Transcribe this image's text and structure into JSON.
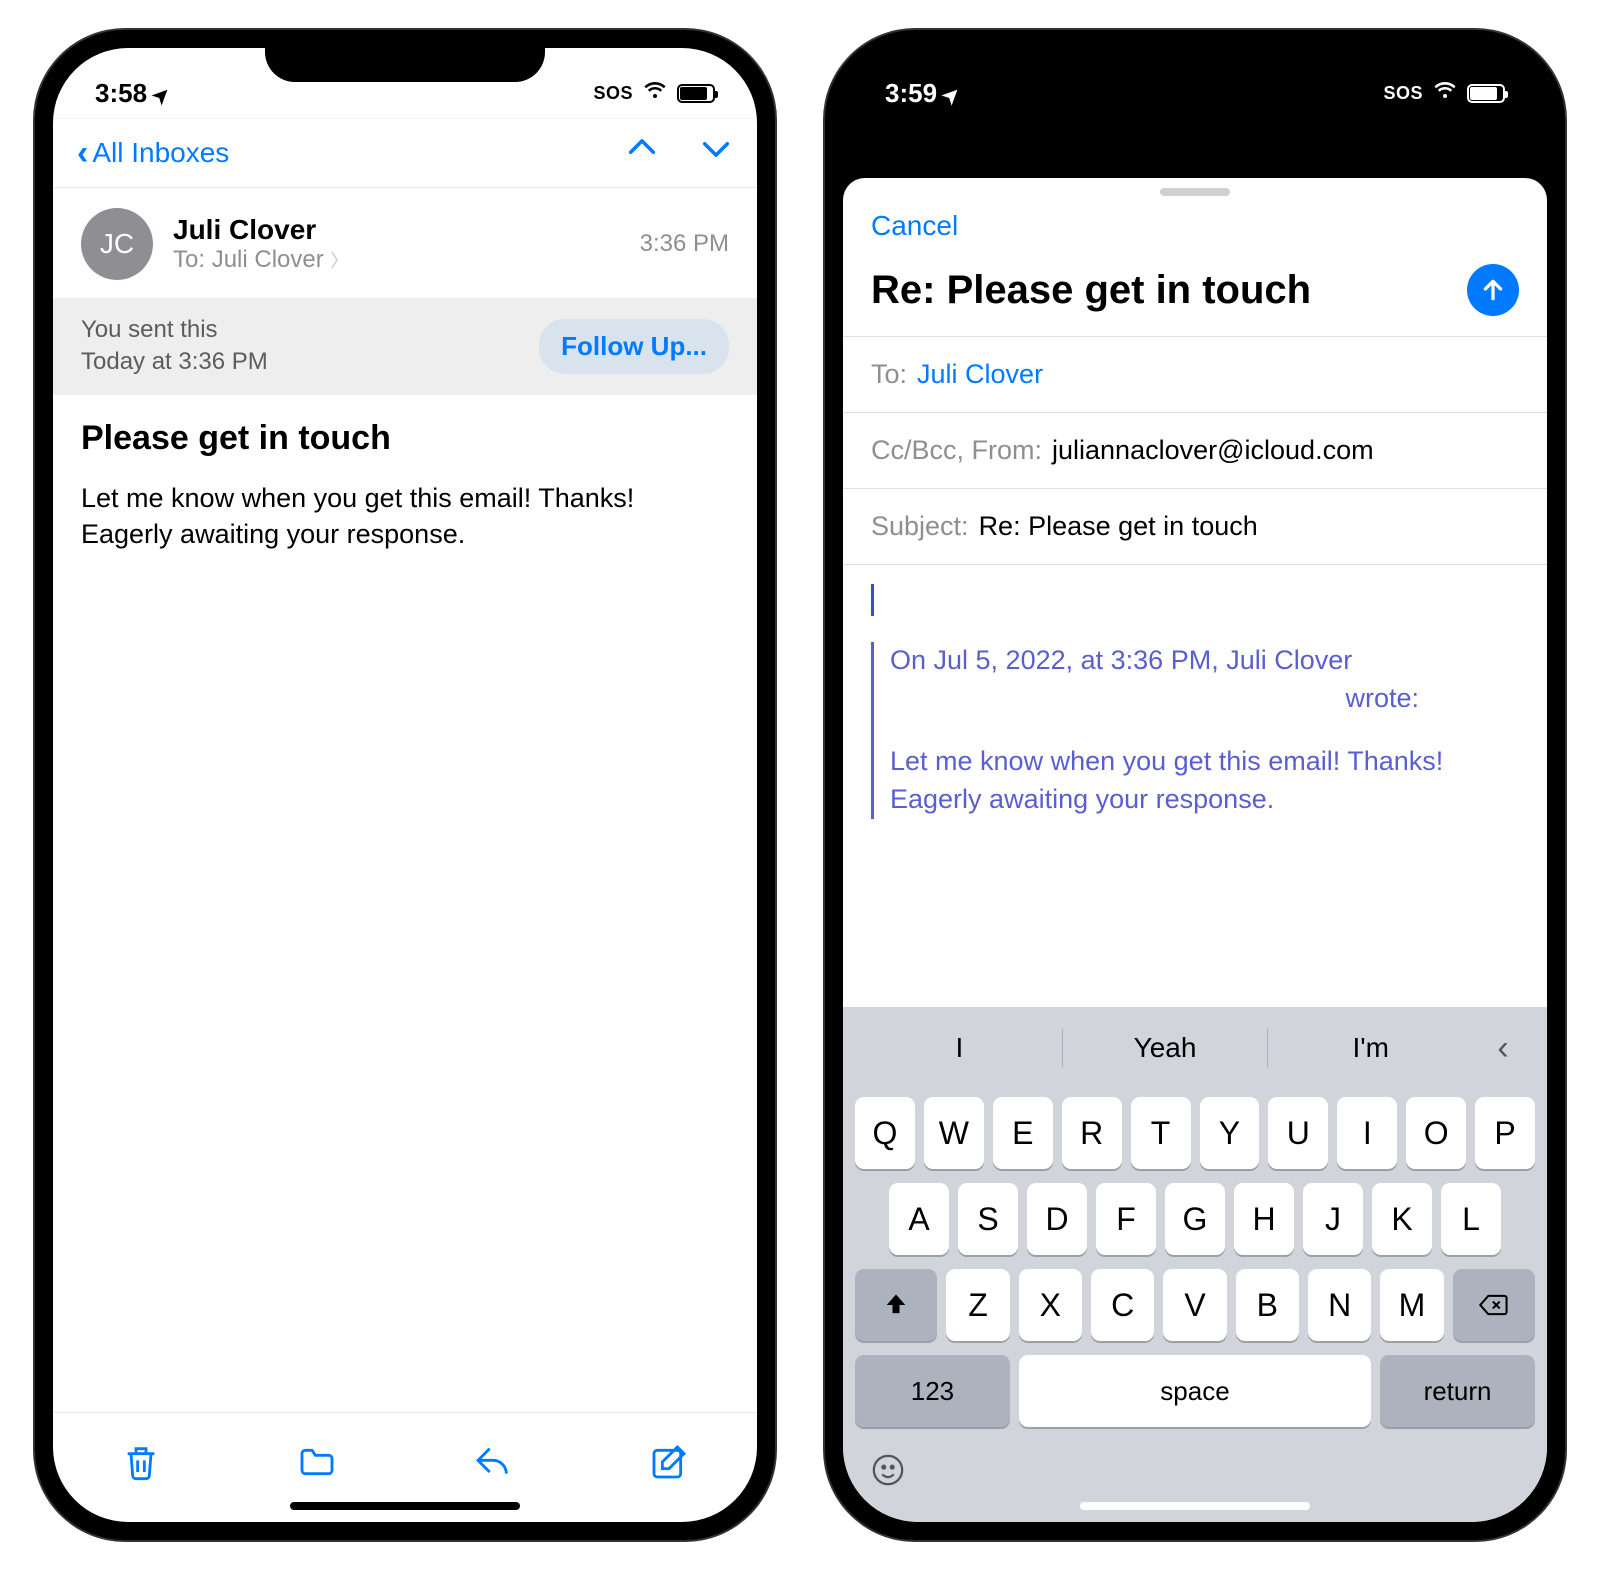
{
  "phone1": {
    "status": {
      "time": "3:58",
      "sos": "SOS"
    },
    "nav": {
      "back": "All Inboxes"
    },
    "sender": {
      "initials": "JC",
      "name": "Juli Clover",
      "to_label": "To:",
      "to_name": "Juli Clover",
      "time": "3:36 PM"
    },
    "banner": {
      "line1": "You sent this",
      "line2": "Today at 3:36 PM",
      "button": "Follow Up..."
    },
    "subject": "Please get in touch",
    "body": "Let me know when you get this email! Thanks! Eagerly awaiting your response."
  },
  "phone2": {
    "status": {
      "time": "3:59",
      "sos": "SOS"
    },
    "cancel": "Cancel",
    "subject": "Re: Please get in touch",
    "fields": {
      "to_label": "To:",
      "to_value": "Juli Clover",
      "ccbcc_label": "Cc/Bcc, From:",
      "from_value": "juliannaclover@icloud.com",
      "subject_label": "Subject:",
      "subject_value": "Re: Please get in touch"
    },
    "quote": {
      "header": "On Jul 5, 2022, at 3:36 PM, Juli Clover",
      "wrote": "wrote:",
      "body": "Let me know when you get this email! Thanks! Eagerly awaiting your response."
    },
    "keyboard": {
      "suggestions": [
        "I",
        "Yeah",
        "I'm"
      ],
      "row1": [
        "Q",
        "W",
        "E",
        "R",
        "T",
        "Y",
        "U",
        "I",
        "O",
        "P"
      ],
      "row2": [
        "A",
        "S",
        "D",
        "F",
        "G",
        "H",
        "J",
        "K",
        "L"
      ],
      "row3": [
        "Z",
        "X",
        "C",
        "V",
        "B",
        "N",
        "M"
      ],
      "num_key": "123",
      "space_key": "space",
      "return_key": "return"
    }
  }
}
